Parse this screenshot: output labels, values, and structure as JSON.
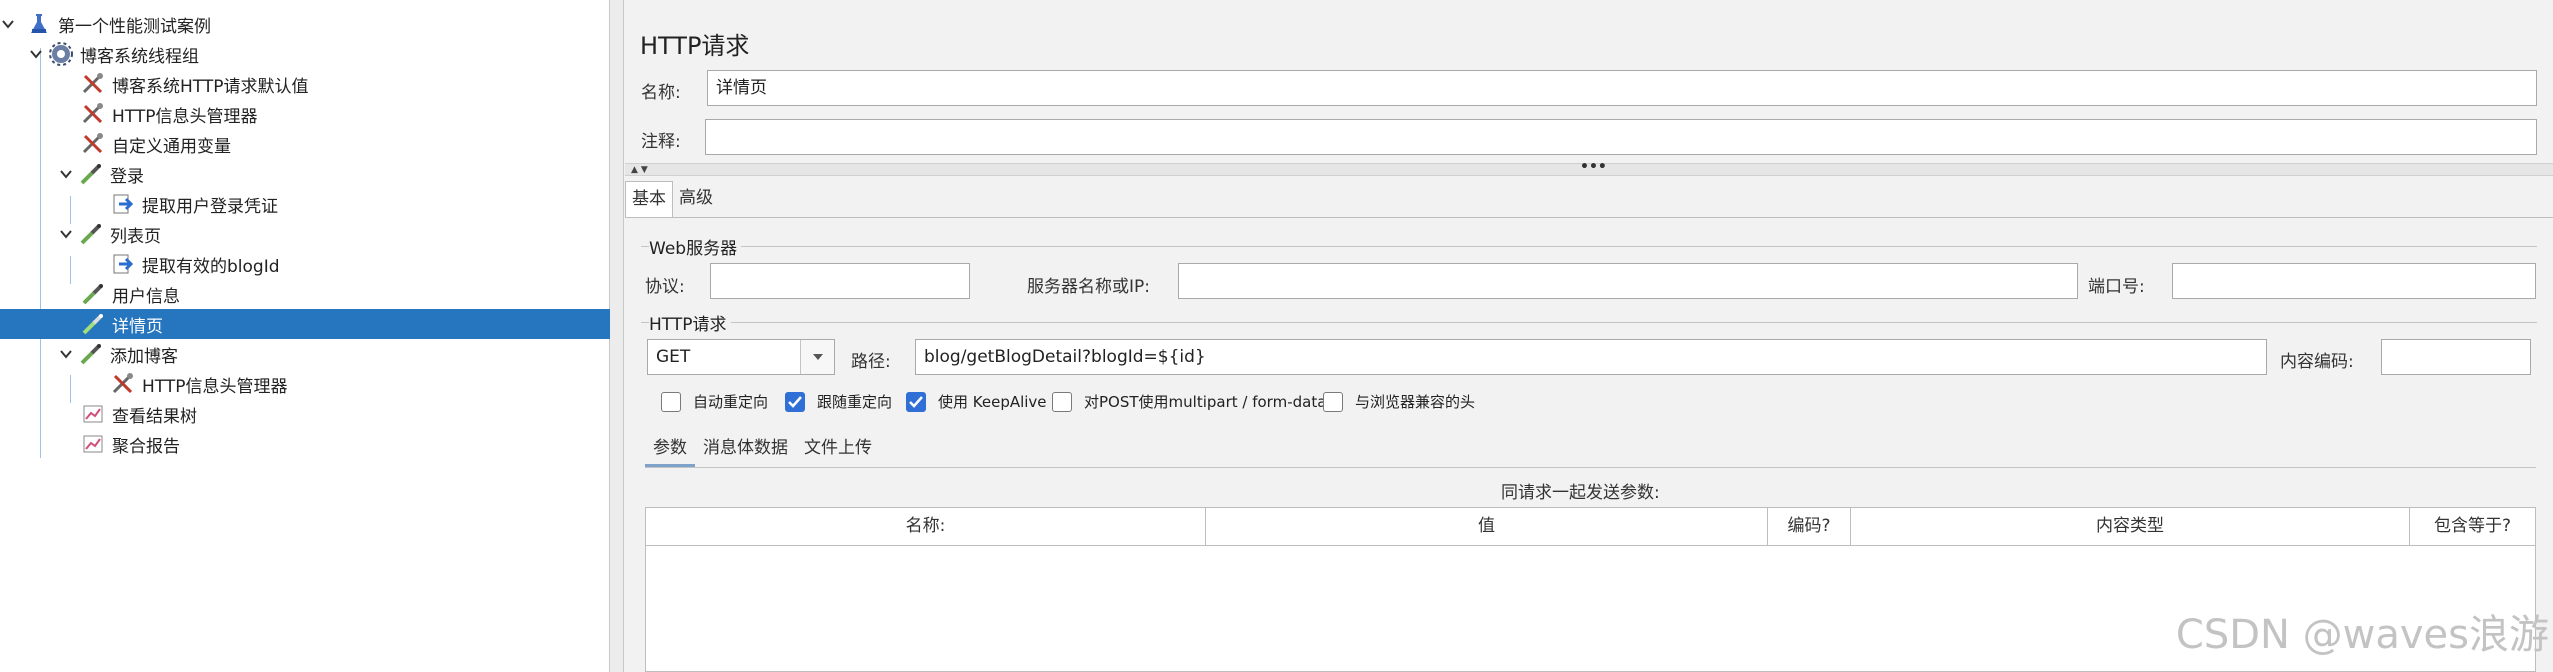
{
  "tree": {
    "items": [
      {
        "label": "第一个性能测试案例",
        "icon": "flask-icon"
      },
      {
        "label": "博客系统线程组",
        "icon": "gear-icon"
      },
      {
        "label": "博客系统HTTP请求默认值",
        "icon": "config-element-icon"
      },
      {
        "label": "HTTP信息头管理器",
        "icon": "config-element-icon"
      },
      {
        "label": "自定义通用变量",
        "icon": "config-element-icon"
      },
      {
        "label": "登录",
        "icon": "sampler-pipette-icon"
      },
      {
        "label": "提取用户登录凭证",
        "icon": "extractor-icon"
      },
      {
        "label": "列表页",
        "icon": "sampler-pipette-icon"
      },
      {
        "label": "提取有效的blogId",
        "icon": "extractor-icon"
      },
      {
        "label": "用户信息",
        "icon": "sampler-pipette-icon"
      },
      {
        "label": "详情页",
        "icon": "sampler-pipette-icon"
      },
      {
        "label": "添加博客",
        "icon": "sampler-pipette-icon"
      },
      {
        "label": "HTTP信息头管理器",
        "icon": "config-element-icon"
      },
      {
        "label": "查看结果树",
        "icon": "listener-chart-icon"
      },
      {
        "label": "聚合报告",
        "icon": "listener-chart-icon"
      }
    ],
    "selected": "详情页"
  },
  "panel": {
    "title": "HTTP请求",
    "name_label": "名称:",
    "name_value": "详情页",
    "comment_label": "注释:",
    "comment_value": "",
    "tabs": [
      "基本",
      "高级"
    ],
    "web_server": {
      "group_title": "Web服务器",
      "protocol_label": "协议:",
      "protocol_value": "",
      "server_label": "服务器名称或IP:",
      "server_value": "",
      "port_label": "端口号:",
      "port_value": ""
    },
    "http_request": {
      "group_title": "HTTP请求",
      "method": "GET",
      "path_label": "路径:",
      "path_value": "blog/getBlogDetail?blogId=${id}",
      "encoding_label": "内容编码:",
      "encoding_value": ""
    },
    "checkboxes": [
      {
        "label": "自动重定向",
        "checked": false
      },
      {
        "label": "跟随重定向",
        "checked": true
      },
      {
        "label": "使用 KeepAlive",
        "checked": true
      },
      {
        "label": "对POST使用multipart / form-data",
        "checked": false
      },
      {
        "label": "与浏览器兼容的头",
        "checked": false
      }
    ],
    "subtabs": [
      "参数",
      "消息体数据",
      "文件上传"
    ],
    "params_caption": "同请求一起发送参数:",
    "table_headers": [
      "名称:",
      "值",
      "编码?",
      "内容类型",
      "包含等于?"
    ]
  },
  "watermark": "CSDN @waves浪游"
}
